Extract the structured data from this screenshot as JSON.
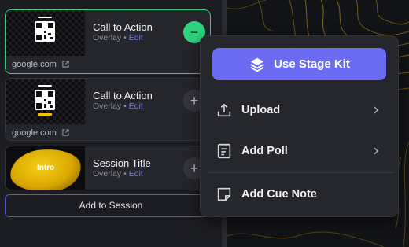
{
  "overlays": [
    {
      "title": "Call to Action",
      "type_label": "Overlay",
      "separator": "•",
      "edit_label": "Edit",
      "footer_link": "google.com",
      "state": "added"
    },
    {
      "title": "Call to Action",
      "type_label": "Overlay",
      "separator": "•",
      "edit_label": "Edit",
      "footer_link": "google.com",
      "state": "not-added"
    },
    {
      "title": "Session Title",
      "type_label": "Overlay",
      "separator": "•",
      "edit_label": "Edit",
      "thumb_text": "Intro",
      "state": "not-added"
    }
  ],
  "buttons": {
    "minus_symbol": "−",
    "plus_symbol": "+",
    "add_to_session": "Add to Session"
  },
  "menu": {
    "stage_kit_label": "Use Stage Kit",
    "items": [
      {
        "label": "Upload",
        "icon": "upload-icon",
        "has_submenu": true
      },
      {
        "label": "Add Poll",
        "icon": "poll-icon",
        "has_submenu": true
      },
      {
        "label": "Add Cue Note",
        "icon": "note-icon",
        "has_submenu": false
      }
    ]
  },
  "colors": {
    "accent": "#6c6cf2",
    "active_green": "#2fd47e",
    "link_blue": "#6f7cff",
    "intro_yellow": "#f2c300",
    "panel_bg": "#1c1d22",
    "menu_bg": "#26272c"
  }
}
